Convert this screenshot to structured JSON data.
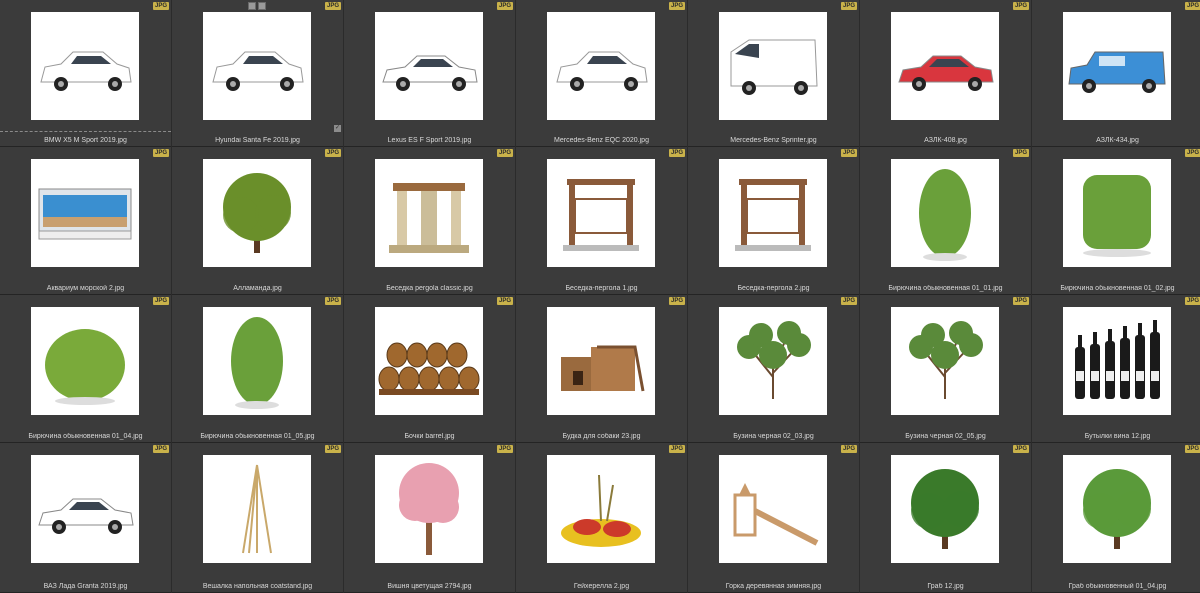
{
  "badge_text": "JPG",
  "items": [
    {
      "label": "BMW X5 M Sport 2019.jpg",
      "icon": "car-suv-white",
      "color": "#ffffff"
    },
    {
      "label": "Hyundai Santa Fe 2019.jpg",
      "icon": "car-suv-white",
      "color": "#ffffff"
    },
    {
      "label": "Lexus ES F Sport 2019.jpg",
      "icon": "car-sedan-white",
      "color": "#ffffff"
    },
    {
      "label": "Mercedes-Benz EQC 2020.jpg",
      "icon": "car-suv-white",
      "color": "#ffffff"
    },
    {
      "label": "Mercedes-Benz Sprinter.jpg",
      "icon": "van-white",
      "color": "#ffffff"
    },
    {
      "label": "АЗЛК-408.jpg",
      "icon": "car-sedan-red",
      "color": "#d9363e"
    },
    {
      "label": "АЗЛК-434.jpg",
      "icon": "car-wagon-blue",
      "color": "#3c8fd6"
    },
    {
      "label": "Аквариум морской 2.jpg",
      "icon": "aquarium",
      "color": "#3a8fd0"
    },
    {
      "label": "Алламанда.jpg",
      "icon": "tree-round",
      "color": "#6a8f2a"
    },
    {
      "label": "Беседка pergola classic.jpg",
      "icon": "pergola-stone",
      "color": "#d8c9a6"
    },
    {
      "label": "Беседка-пергола 1.jpg",
      "icon": "pergola-wood",
      "color": "#8a5a3a"
    },
    {
      "label": "Беседка-пергола 2.jpg",
      "icon": "pergola-wood",
      "color": "#8a5a3a"
    },
    {
      "label": "Бирючина обыкновенная 01_01.jpg",
      "icon": "bush-tall",
      "color": "#6aa03a"
    },
    {
      "label": "Бирючина обыкновенная 01_02.jpg",
      "icon": "bush-box",
      "color": "#6aa03a"
    },
    {
      "label": "Бирючина обыкновенная 01_04.jpg",
      "icon": "bush-round",
      "color": "#7aaa3a"
    },
    {
      "label": "Бирючина обыкновенная 01_05.jpg",
      "icon": "bush-tall",
      "color": "#6aa03a"
    },
    {
      "label": "Бочки barrel.jpg",
      "icon": "barrels",
      "color": "#a0682e"
    },
    {
      "label": "Будка для собаки 23.jpg",
      "icon": "dog-house",
      "color": "#9a6a3e"
    },
    {
      "label": "Бузина черная 02_03.jpg",
      "icon": "shrub-sparse",
      "color": "#5a8a3a"
    },
    {
      "label": "Бузина черная 02_05.jpg",
      "icon": "shrub-sparse",
      "color": "#5a8a3a"
    },
    {
      "label": "Бутылки вина 12.jpg",
      "icon": "wine-bottles",
      "color": "#1a1a1a"
    },
    {
      "label": "ВАЗ Лада Granta 2019.jpg",
      "icon": "car-sedan-white",
      "color": "#ffffff"
    },
    {
      "label": "Вешалка напольная coatstand.jpg",
      "icon": "coatstand",
      "color": "#c9a86a"
    },
    {
      "label": "Вишня цветущая 2794.jpg",
      "icon": "tree-blossom",
      "color": "#e8a0b0"
    },
    {
      "label": "Гейхерелла 2.jpg",
      "icon": "flower-plant",
      "color": "#e8c020"
    },
    {
      "label": "Горка деревянная зимняя.jpg",
      "icon": "wood-slide",
      "color": "#c99a6a"
    },
    {
      "label": "Граб 12.jpg",
      "icon": "tree-round",
      "color": "#3a7a2a"
    },
    {
      "label": "Граб обыкновенный 01_04.jpg",
      "icon": "tree-round",
      "color": "#5a9a3a"
    }
  ]
}
